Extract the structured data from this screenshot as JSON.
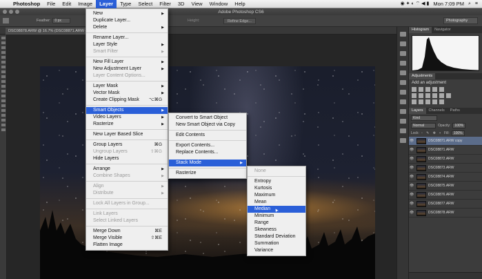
{
  "menubar": {
    "app": "Photoshop",
    "items": [
      "File",
      "Edit",
      "Image",
      "Layer",
      "Type",
      "Select",
      "Filter",
      "3D",
      "View",
      "Window",
      "Help"
    ],
    "clock": "Mon 7:09 PM"
  },
  "window": {
    "title": "Adobe Photoshop CS6",
    "doc_tab": "DSC08878.ARW @ 16.7% (DSC08871.ARW co"
  },
  "options": {
    "feather_label": "Feather:",
    "feather_value": "0 px",
    "height_label": "Height:",
    "refine_edge": "Refine Edge...",
    "workspace": "Photography"
  },
  "layer_menu": {
    "items": [
      {
        "label": "New",
        "arrow": true
      },
      {
        "label": "Duplicate Layer..."
      },
      {
        "label": "Delete",
        "arrow": true
      },
      {
        "sep": true
      },
      {
        "label": "Rename Layer..."
      },
      {
        "label": "Layer Style",
        "arrow": true
      },
      {
        "label": "Smart Filter",
        "arrow": true,
        "disabled": true
      },
      {
        "sep": true
      },
      {
        "label": "New Fill Layer",
        "arrow": true
      },
      {
        "label": "New Adjustment Layer",
        "arrow": true
      },
      {
        "label": "Layer Content Options...",
        "disabled": true
      },
      {
        "sep": true
      },
      {
        "label": "Layer Mask",
        "arrow": true
      },
      {
        "label": "Vector Mask",
        "arrow": true
      },
      {
        "label": "Create Clipping Mask",
        "shortcut": "⌥⌘G"
      },
      {
        "sep": true
      },
      {
        "label": "Smart Objects",
        "arrow": true,
        "highlight": true
      },
      {
        "label": "Video Layers",
        "arrow": true
      },
      {
        "label": "Rasterize",
        "arrow": true
      },
      {
        "sep": true
      },
      {
        "label": "New Layer Based Slice"
      },
      {
        "sep": true
      },
      {
        "label": "Group Layers",
        "shortcut": "⌘G"
      },
      {
        "label": "Ungroup Layers",
        "shortcut": "⇧⌘G",
        "disabled": true
      },
      {
        "label": "Hide Layers"
      },
      {
        "sep": true
      },
      {
        "label": "Arrange",
        "arrow": true
      },
      {
        "label": "Combine Shapes",
        "arrow": true,
        "disabled": true
      },
      {
        "sep": true
      },
      {
        "label": "Align",
        "arrow": true,
        "disabled": true
      },
      {
        "label": "Distribute",
        "arrow": true,
        "disabled": true
      },
      {
        "sep": true
      },
      {
        "label": "Lock All Layers in Group...",
        "disabled": true
      },
      {
        "sep": true
      },
      {
        "label": "Link Layers",
        "disabled": true
      },
      {
        "label": "Select Linked Layers",
        "disabled": true
      },
      {
        "sep": true
      },
      {
        "label": "Merge Down",
        "shortcut": "⌘E"
      },
      {
        "label": "Merge Visible",
        "shortcut": "⇧⌘E"
      },
      {
        "label": "Flatten Image"
      }
    ]
  },
  "smart_objects_menu": {
    "items": [
      {
        "label": "Convert to Smart Object"
      },
      {
        "label": "New Smart Object via Copy"
      },
      {
        "sep": true
      },
      {
        "label": "Edit Contents"
      },
      {
        "sep": true
      },
      {
        "label": "Export Contents..."
      },
      {
        "label": "Replace Contents..."
      },
      {
        "gap": true
      },
      {
        "label": "Stack Mode",
        "arrow": true,
        "highlight": true
      },
      {
        "sep": true
      },
      {
        "label": "Rasterize"
      }
    ]
  },
  "stack_mode_menu": {
    "items": [
      {
        "label": "None",
        "disabled": true
      },
      {
        "sep": true
      },
      {
        "label": "Entropy"
      },
      {
        "label": "Kurtosis"
      },
      {
        "label": "Maximum"
      },
      {
        "label": "Mean"
      },
      {
        "label": "Median",
        "highlight": true
      },
      {
        "label": "Minimum"
      },
      {
        "label": "Range"
      },
      {
        "label": "Skewness"
      },
      {
        "label": "Standard Deviation"
      },
      {
        "label": "Summation"
      },
      {
        "label": "Variance"
      }
    ]
  },
  "panels": {
    "histogram_tabs": [
      "Histogram",
      "Navigator"
    ],
    "adjustments_title": "Adjustments",
    "add_adjustment": "Add an adjustment",
    "layers_tabs": [
      "Layers",
      "Channels",
      "Paths"
    ],
    "kind_label": "Kind",
    "blend_mode": "Normal",
    "opacity_label": "Opacity:",
    "opacity_value": "100%",
    "lock_label": "Lock:",
    "fill_label": "Fill:",
    "fill_value": "100%",
    "layers": [
      "DSC08871.ARW copy",
      "DSC08871.ARW",
      "DSC08872.ARW",
      "DSC08873.ARW",
      "DSC08874.ARW",
      "DSC08875.ARW",
      "DSC08876.ARW",
      "DSC08877.ARW",
      "DSC08878.ARW"
    ]
  }
}
